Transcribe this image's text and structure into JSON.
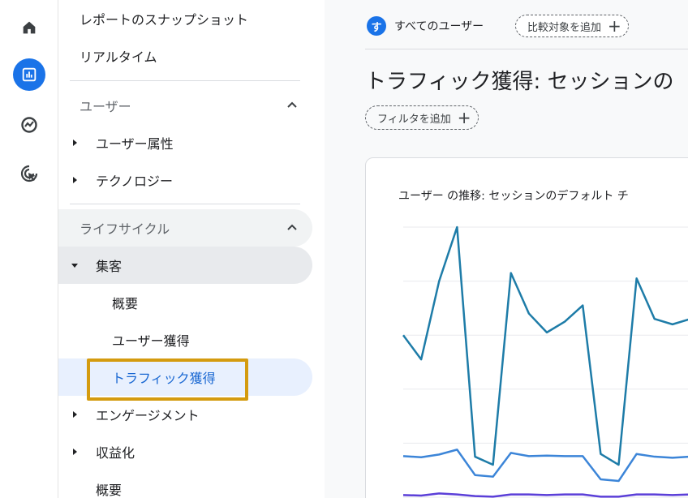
{
  "rail": {
    "items": [
      {
        "name": "home-icon",
        "active": false
      },
      {
        "name": "reports-icon",
        "active": true
      },
      {
        "name": "explore-icon",
        "active": false
      },
      {
        "name": "advertising-icon",
        "active": false
      }
    ],
    "colors": {
      "active": "#1a73e8",
      "icon": "#3c4043"
    }
  },
  "nav": {
    "snapshot": "レポートのスナップショット",
    "realtime": "リアルタイム",
    "users_section": "ユーザー",
    "user_attributes": "ユーザー属性",
    "technology": "テクノロジー",
    "lifecycle_section": "ライフサイクル",
    "acquisition": "集客",
    "overview": "概要",
    "user_acquisition": "ユーザー獲得",
    "traffic_acquisition": "トラフィック獲得",
    "engagement": "エンゲージメント",
    "monetization": "収益化",
    "overview2": "概要"
  },
  "header": {
    "segment_avatar": "す",
    "segment_label": "すべてのユーザー",
    "compare_label": "比較対象を追加",
    "plus": "+"
  },
  "page": {
    "title": "トラフィック獲得: セッションの",
    "filter_label": "フィルタを追加",
    "plus": "+"
  },
  "card": {
    "title": "ユーザー の推移: セッションのデフォルト チ"
  },
  "chart_data": {
    "type": "line",
    "x": [
      1,
      2,
      3,
      4,
      5,
      6,
      7,
      8,
      9,
      10,
      11,
      12,
      13,
      14,
      15,
      16,
      17
    ],
    "series": [
      {
        "color": "#1e7ca8",
        "values": [
          300,
          255,
          400,
          500,
          75,
          60,
          415,
          340,
          305,
          325,
          355,
          80,
          60,
          405,
          330,
          320,
          330
        ]
      },
      {
        "color": "#3c85d8",
        "values": [
          76,
          74,
          79,
          88,
          41,
          38,
          82,
          76,
          77,
          76,
          76,
          33,
          30,
          80,
          75,
          73,
          75
        ]
      },
      {
        "color": "#5b3fd8",
        "values": [
          4,
          3,
          7,
          5,
          2,
          1,
          5,
          5,
          4,
          5,
          5,
          1,
          1,
          5,
          5,
          4,
          5
        ]
      }
    ],
    "ylim": [
      0,
      500
    ],
    "grid": true
  }
}
